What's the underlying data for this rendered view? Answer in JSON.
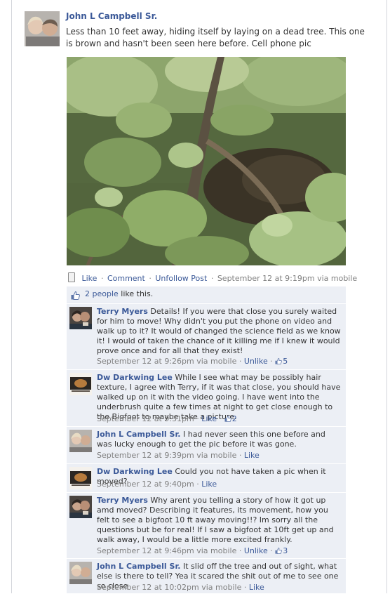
{
  "post": {
    "author": "John L Campbell Sr.",
    "text": "Less than 10 feet away, hiding itself by laying on a dead tree. This one is brown and hasn't been seen here before. Cell phone pic",
    "actions": {
      "like": "Like",
      "comment": "Comment",
      "unfollow": "Unfollow Post",
      "timestamp": "September 12 at 9:19pm via mobile"
    },
    "likes": {
      "count_link": "2 people",
      "suffix": " like this."
    }
  },
  "comments": [
    {
      "author": "Terry Myers",
      "text": " Details! If you were that close you surely waited for him to move! Why didn't you put the phone on video and walk up to it? It would of changed the science field as we know it! I would of taken the chance of it killing me if I knew it would prove once and for all that they exist!",
      "time": "September 12 at 9:26pm via mobile",
      "action": "Unlike",
      "likes": "5"
    },
    {
      "author": "Dw Darkwing Lee",
      "text": " While I see what may be possibly hair texture, I agree with Terry, if it was that close, you should have walked up on it with the video going. I have went into the underbrush quite a few times at night to get close enough to the Bigfoot to maybe take a picture.",
      "time": "September 12 at 9:31pm",
      "action": "Like",
      "likes": "2"
    },
    {
      "author": "John L Campbell Sr.",
      "text": " I had never seen this one before and was lucky enough to get the pic before it was gone.",
      "time": "September 12 at 9:39pm via mobile",
      "action": "Like"
    },
    {
      "author": "Dw Darkwing Lee",
      "text": " Could you not have taken a pic when it moved?",
      "time": "September 12 at 9:40pm",
      "action": "Like"
    },
    {
      "author": "Terry Myers",
      "text": " Why arent you telling a story of how it got up amd moved? Describing it features, its movement, how you felt to see a bigfoot 10 ft away moving!!? Im sorry all the questions but be for real! If I saw a bigfoot at 10ft get up and walk away, I would be a little more excited frankly.",
      "time": "September 12 at 9:46pm via mobile",
      "action": "Unlike",
      "likes": "3"
    },
    {
      "author": "John L Campbell Sr.",
      "text": " It slid off the tree and out of sight, what else is there to tell? Yea it scared the shit out of me to see one so close",
      "time": "September 12 at 10:02pm via mobile",
      "action": "Like"
    }
  ],
  "colors": {
    "link": "#3b5998",
    "meta": "#808080",
    "comment_bg": "#eceff5"
  }
}
